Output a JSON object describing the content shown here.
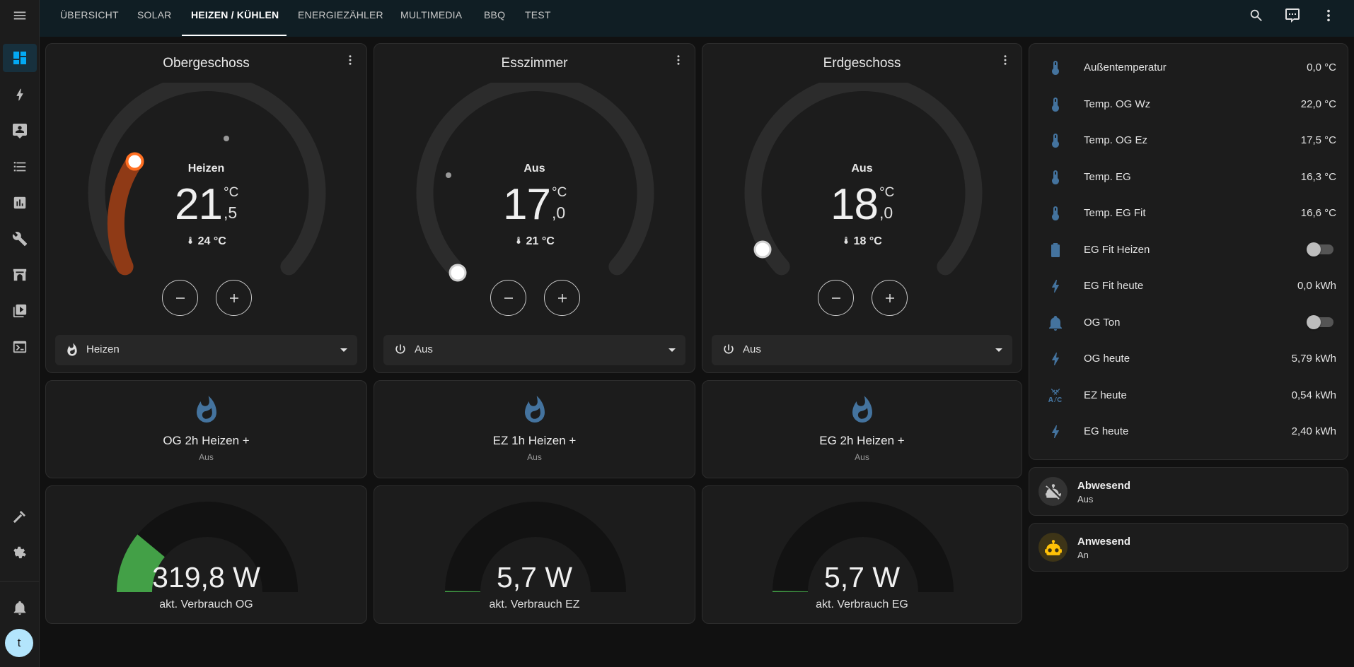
{
  "nav": {
    "tabs": [
      {
        "label": "ÜBERSICHT"
      },
      {
        "label": "SOLAR"
      },
      {
        "label": "HEIZEN / KÜHLEN"
      },
      {
        "label": "ENERGIEZÄHLER"
      },
      {
        "label": "MULTIMEDIA"
      },
      {
        "label": "BBQ"
      },
      {
        "label": "TEST"
      }
    ],
    "active_tab": "HEIZEN / KÜHLEN"
  },
  "sidebar": {
    "icons": [
      "dashboard-icon",
      "lightning-icon",
      "map-person-icon",
      "list-icon",
      "chart-icon",
      "wrench-icon",
      "fireplace-icon",
      "media-icon",
      "terminal-icon",
      "hammer-icon",
      "gear-icon",
      "bell-icon"
    ],
    "user_initial": "t"
  },
  "thermostats": [
    {
      "name": "Obergeschoss",
      "mode": "Heizen",
      "target_int": "21",
      "target_dec": ",5",
      "unit": "°C",
      "current": "24 °C",
      "select_label": "Heizen",
      "select_icon": "fire-icon",
      "target": 21.5,
      "current_value": 24,
      "active": true,
      "color": "#8f3a16"
    },
    {
      "name": "Esszimmer",
      "mode": "Aus",
      "target_int": "17",
      "target_dec": ",0",
      "unit": "°C",
      "current": "21 °C",
      "select_label": "Aus",
      "select_icon": "power-icon",
      "target": 17.0,
      "current_value": 21,
      "active": false
    },
    {
      "name": "Erdgeschoss",
      "mode": "Aus",
      "target_int": "18",
      "target_dec": ",0",
      "unit": "°C",
      "current": "18 °C",
      "select_label": "Aus",
      "select_icon": "power-icon",
      "target": 18.0,
      "current_value": 18,
      "active": false
    }
  ],
  "buttons": [
    {
      "title": "OG 2h Heizen +",
      "state": "Aus"
    },
    {
      "title": "EZ 1h Heizen +",
      "state": "Aus"
    },
    {
      "title": "EG 2h Heizen +",
      "state": "Aus"
    }
  ],
  "gauges": [
    {
      "value": "319,8 W",
      "name": "akt. Verbrauch OG",
      "fraction": 0.22,
      "color": "#43a047"
    },
    {
      "value": "5,7 W",
      "name": "akt. Verbrauch EZ",
      "fraction": 0.004,
      "color": "#43a047"
    },
    {
      "value": "5,7 W",
      "name": "akt. Verbrauch EG",
      "fraction": 0.004,
      "color": "#43a047"
    }
  ],
  "entities": [
    {
      "name": "Außentemperatur",
      "value": "0,0 °C",
      "icon": "thermometer-icon"
    },
    {
      "name": "Temp. OG Wz",
      "value": "22,0 °C",
      "icon": "thermometer-icon"
    },
    {
      "name": "Temp. OG Ez",
      "value": "17,5 °C",
      "icon": "thermometer-icon"
    },
    {
      "name": "Temp. EG",
      "value": "16,3 °C",
      "icon": "thermometer-icon"
    },
    {
      "name": "Temp. EG Fit",
      "value": "16,6 °C",
      "icon": "thermometer-icon"
    },
    {
      "name": "EG Fit Heizen",
      "toggle": false,
      "icon": "battery-icon"
    },
    {
      "name": "EG Fit heute",
      "value": "0,0 kWh",
      "icon": "lightning-icon"
    },
    {
      "name": "OG Ton",
      "toggle": false,
      "icon": "bell-icon"
    },
    {
      "name": "OG heute",
      "value": "5,79 kWh",
      "icon": "lightning-icon"
    },
    {
      "name": "EZ heute",
      "value": "0,54 kWh",
      "icon": "air-conditioner-icon"
    },
    {
      "name": "EG heute",
      "value": "2,40 kWh",
      "icon": "lightning-icon"
    }
  ],
  "tiles": [
    {
      "title": "Abwesend",
      "state": "Aus",
      "icon": "robot-off-icon"
    },
    {
      "title": "Anwesend",
      "state": "An",
      "icon": "robot-icon",
      "color": "#ffc107"
    }
  ],
  "colors": {
    "accent": "#44739e",
    "heat": "#8f3a16",
    "handle_heat": "#ff6f22",
    "gauge_green": "#43a047",
    "tile_on": "#ffc107"
  }
}
